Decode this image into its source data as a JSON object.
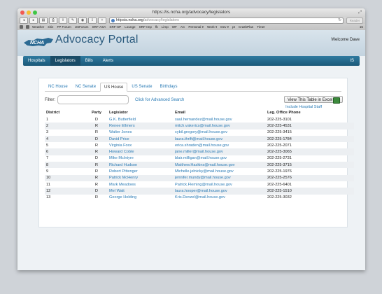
{
  "browser": {
    "window_title": "https://is.ncha.org/advocacy/legislators",
    "url_secure": "https",
    "url_host": "is.ncha.org",
    "url_path": "/advocacy/legislators",
    "reader_label": "Reader",
    "bookmark_count": "15",
    "bookmarks": [
      "Weather",
      "shiz",
      "FP Forum",
      "USForum",
      "SRF-ASA",
      "SRF-SP",
      "Lounge",
      "SRF-Imp",
      "fb",
      "Limp",
      "WF",
      "AC",
      "Personal ▾",
      "Work ▾",
      "Dev ▾",
      "pt",
      "CrashPlan",
      "Timer"
    ]
  },
  "header": {
    "portal_title": "Advocacy Portal",
    "welcome": "Welcome Dave",
    "nav": [
      {
        "label": "Hospitals",
        "active": false
      },
      {
        "label": "Legislators",
        "active": true
      },
      {
        "label": "Bills",
        "active": false
      },
      {
        "label": "Alerts",
        "active": false
      }
    ],
    "nav_right": "IS"
  },
  "tabs": [
    {
      "label": "NC House",
      "active": false
    },
    {
      "label": "NC Senate",
      "active": false
    },
    {
      "label": "US House",
      "active": true
    },
    {
      "label": "US Senate",
      "active": false
    },
    {
      "label": "Birthdays",
      "active": false
    }
  ],
  "filter": {
    "label": "Filter:",
    "value": "",
    "advanced_link": "Click for Advanced Search"
  },
  "excel_button": "View This Table in Excel",
  "hospital_staff_link": "Include Hospital Staff",
  "columns": [
    "District",
    "Party",
    "Legislator",
    "Email",
    "Leg. Office Phone"
  ],
  "rows": [
    {
      "district": "1",
      "party": "D",
      "legislator": "G.K. Butterfield",
      "email": "saul.hernandez@mail.house.gov",
      "phone": "202-225-3101"
    },
    {
      "district": "2",
      "party": "R",
      "legislator": "Renee Ellmers",
      "email": "mitch.vakerics@mail.house.gov",
      "phone": "202-225-4531"
    },
    {
      "district": "3",
      "party": "R",
      "legislator": "Walter Jones",
      "email": "cybil.gregory@mail.house.gov",
      "phone": "202-225-3415"
    },
    {
      "district": "4",
      "party": "D",
      "legislator": "David Price",
      "email": "laura.thrift@mail.house.gov",
      "phone": "202-225-1784"
    },
    {
      "district": "5",
      "party": "R",
      "legislator": "Virginia Foxx",
      "email": "erica.shraden@mail.house.gov",
      "phone": "202-225-2071"
    },
    {
      "district": "6",
      "party": "R",
      "legislator": "Howard Coble",
      "email": "jane.miller@mail.house.gov",
      "phone": "202-225-3065"
    },
    {
      "district": "7",
      "party": "D",
      "legislator": "Mike McIntyre",
      "email": "blair.milligan@mail.house.gov",
      "phone": "202-225-2731"
    },
    {
      "district": "8",
      "party": "R",
      "legislator": "Richard Hudson",
      "email": "Matthew.Haskins@mail.house.gov",
      "phone": "202-225-3715"
    },
    {
      "district": "9",
      "party": "R",
      "legislator": "Robert Pittenger",
      "email": "Michelle.jelnicky@mail.house.gov",
      "phone": "202-225-1976"
    },
    {
      "district": "10",
      "party": "R",
      "legislator": "Patrick McHenry",
      "email": "jennifer.mundy@mail.house.gov",
      "phone": "202-225-2576"
    },
    {
      "district": "11",
      "party": "R",
      "legislator": "Mark Meadows",
      "email": "Patrick.Fleming@mail.house.gov",
      "phone": "202-225-6401"
    },
    {
      "district": "12",
      "party": "D",
      "legislator": "Mel Watt",
      "email": "laura.hooper@mail.house.gov",
      "phone": "202-225-1510"
    },
    {
      "district": "13",
      "party": "R",
      "legislator": "George Holding",
      "email": "Kris.Denzel@mail.house.gov",
      "phone": "202-225-3032"
    }
  ]
}
